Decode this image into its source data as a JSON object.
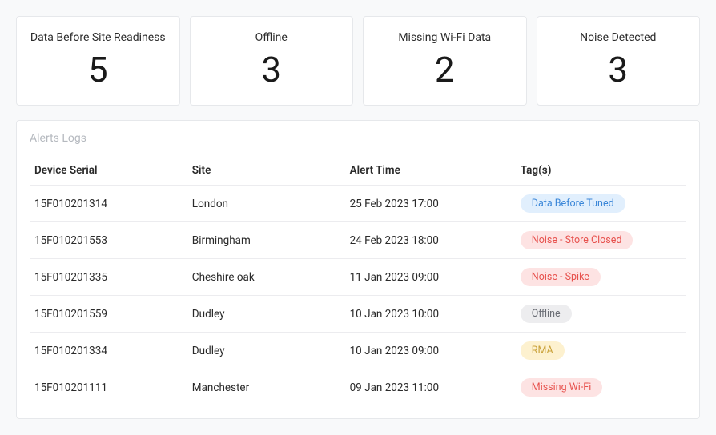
{
  "stats": [
    {
      "label": "Data Before Site Readiness",
      "value": "5"
    },
    {
      "label": "Offline",
      "value": "3"
    },
    {
      "label": "Missing Wi-Fi Data",
      "value": "2"
    },
    {
      "label": "Noise Detected",
      "value": "3"
    }
  ],
  "panel": {
    "title": "Alerts Logs",
    "columns": {
      "serial": "Device Serial",
      "site": "Site",
      "time": "Alert Time",
      "tags": "Tag(s)"
    },
    "rows": [
      {
        "serial": "15F010201314",
        "site": "London",
        "time": "25 Feb 2023 17:00",
        "tag": {
          "text": "Data Before Tuned",
          "bg": "#e1effd",
          "fg": "#3a86d8"
        }
      },
      {
        "serial": "15F010201553",
        "site": "Birmingham",
        "time": "24 Feb 2023 18:00",
        "tag": {
          "text": "Noise - Store Closed",
          "bg": "#fde3e3",
          "fg": "#e7514d"
        }
      },
      {
        "serial": "15F010201335",
        "site": "Cheshire oak",
        "time": "11 Jan 2023 09:00",
        "tag": {
          "text": "Noise - Spike",
          "bg": "#fde3e3",
          "fg": "#e7514d"
        }
      },
      {
        "serial": "15F010201559",
        "site": "Dudley",
        "time": "10 Jan 2023 10:00",
        "tag": {
          "text": "Offline",
          "bg": "#ededef",
          "fg": "#6b6e75"
        }
      },
      {
        "serial": "15F010201334",
        "site": "Dudley",
        "time": "10 Jan 2023 09:00",
        "tag": {
          "text": "RMA",
          "bg": "#fdf1cf",
          "fg": "#caa23a"
        }
      },
      {
        "serial": "15F010201111",
        "site": "Manchester",
        "time": "09 Jan 2023 11:00",
        "tag": {
          "text": "Missing Wi-Fi",
          "bg": "#fde3e3",
          "fg": "#e7514d"
        }
      }
    ]
  }
}
